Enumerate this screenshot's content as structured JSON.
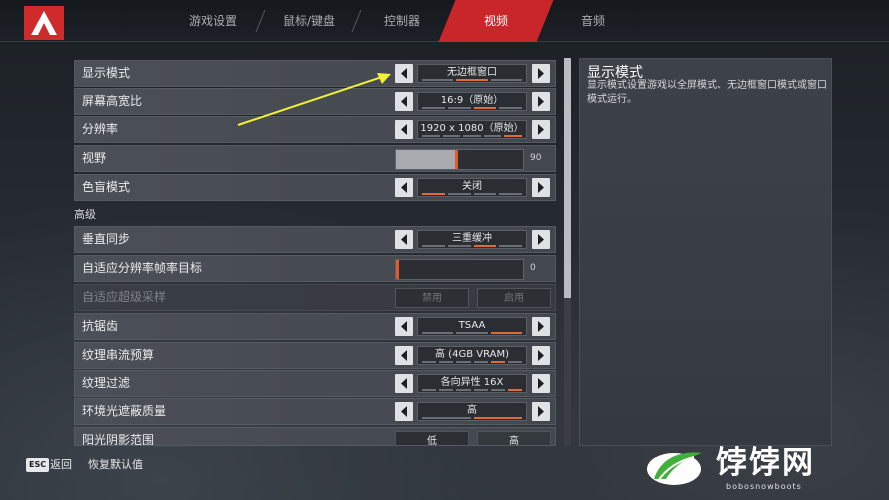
{
  "tabs": [
    {
      "label": "游戏设置",
      "active": false
    },
    {
      "label": "鼠标/键盘",
      "active": false
    },
    {
      "label": "控制器",
      "active": false
    },
    {
      "label": "视频",
      "active": true
    },
    {
      "label": "音频",
      "active": false
    }
  ],
  "settings": [
    {
      "label": "显示模式",
      "type": "select",
      "value": "无边框窗口"
    },
    {
      "label": "屏幕高宽比",
      "type": "select",
      "value": "16:9（原始）"
    },
    {
      "label": "分辨率",
      "type": "select",
      "value": "1920 x 1080（原始）"
    },
    {
      "label": "视野",
      "type": "slider",
      "value": "90",
      "fraction": 0.48
    },
    {
      "label": "色盲模式",
      "type": "select",
      "value": "关闭"
    }
  ],
  "advanced_label": "高级",
  "advanced": [
    {
      "label": "垂直同步",
      "type": "select",
      "value": "三重缓冲"
    },
    {
      "label": "自适应分辨率帧率目标",
      "type": "slider",
      "value": "0",
      "fraction": 0.0
    },
    {
      "label": "自适应超级采样",
      "type": "toggle",
      "options": [
        "禁用",
        "启用"
      ],
      "selected": 0,
      "disabled": true
    },
    {
      "label": "抗锯齿",
      "type": "select",
      "value": "TSAA"
    },
    {
      "label": "纹理串流预算",
      "type": "select",
      "value": "高 (4GB VRAM)"
    },
    {
      "label": "纹理过滤",
      "type": "select",
      "value": "各向异性 16X"
    },
    {
      "label": "环境光遮蔽质量",
      "type": "select",
      "value": "高"
    },
    {
      "label": "阳光阴影范围",
      "type": "toggle",
      "options": [
        "低",
        "高"
      ],
      "selected": 1,
      "disabled": false
    }
  ],
  "description": {
    "title": "显示模式",
    "body": "显示模式设置游戏以全屏模式、无边框窗口模式或窗口模式运行。"
  },
  "footer": {
    "key": "ESC",
    "back": "返回",
    "reset": "恢复默认值"
  },
  "watermark": {
    "text": "饽饽网",
    "sub": "bobosnowboots"
  },
  "colors": {
    "accent": "#c9262a",
    "tick_active": "#e06a3a",
    "annotation": "#f2f034"
  }
}
